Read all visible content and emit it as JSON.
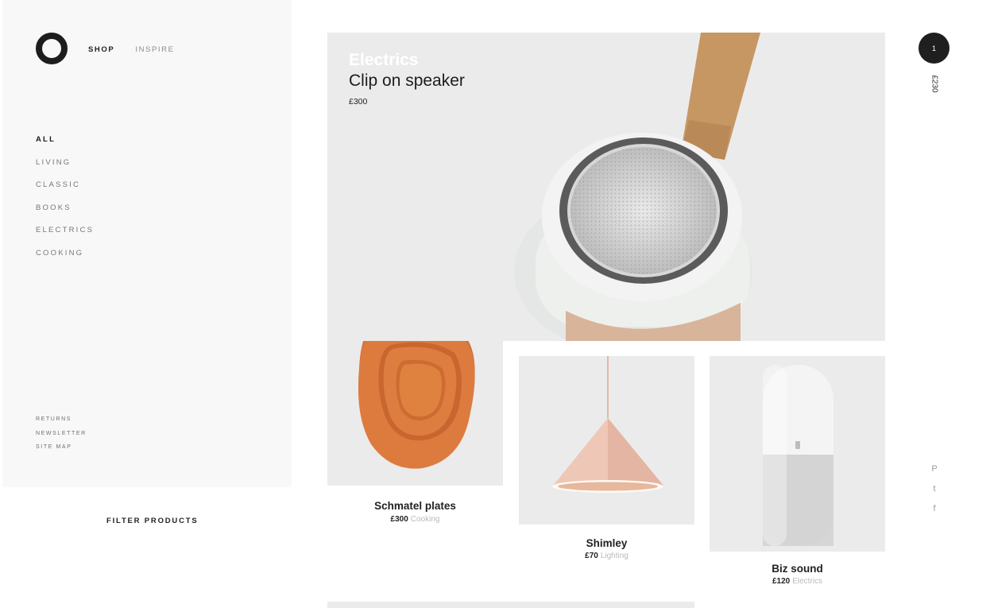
{
  "nav": {
    "shop": "SHOP",
    "inspire": "INSPIRE"
  },
  "categories": [
    "ALL",
    "LIVING",
    "CLASSIC",
    "BOOKS",
    "ELECTRICS",
    "COOKING"
  ],
  "footer_links": [
    "RETURNS",
    "NEWSLETTER",
    "SITE MAP"
  ],
  "filter_label": "FILTER PRODUCTS",
  "hero": {
    "category": "Electrics",
    "title": "Clip on speaker",
    "price": "£300"
  },
  "products": [
    {
      "name": "Schmatel plates",
      "price": "£300",
      "category": "Cooking"
    },
    {
      "name": "Shimley",
      "price": "£70",
      "category": "Lighting"
    },
    {
      "name": "Biz sound",
      "price": "£120",
      "category": "Electrics"
    }
  ],
  "cart": {
    "count": "1",
    "total": "£230"
  },
  "social": {
    "pinterest": "P",
    "twitter": "t",
    "facebook": "f"
  },
  "colors": {
    "accent": "#1f1f1f",
    "tile_bg": "#ebebeb",
    "sidebar_bg": "#f8f8f8",
    "muted_text": "#b9b9b9"
  }
}
